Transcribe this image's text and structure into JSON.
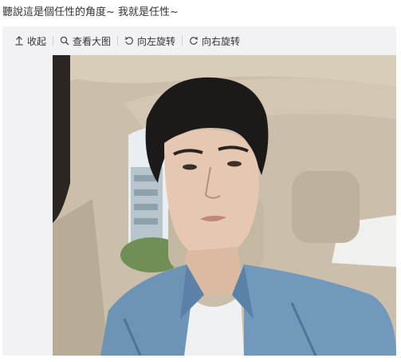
{
  "post": {
    "text": "聽說這是個任性的角度~ 我就是任性~"
  },
  "toolbar": {
    "items": [
      {
        "icon": "arrow-up-icon",
        "label": "收起"
      },
      {
        "icon": "magnifier-icon",
        "label": "查看大图"
      },
      {
        "icon": "rotate-left-icon",
        "label": "向左旋转"
      },
      {
        "icon": "rotate-right-icon",
        "label": "向右旋转"
      }
    ]
  },
  "colors": {
    "viewer_bg": "#f2f2f5",
    "text": "#333333",
    "separator": "#d0d0d6"
  }
}
